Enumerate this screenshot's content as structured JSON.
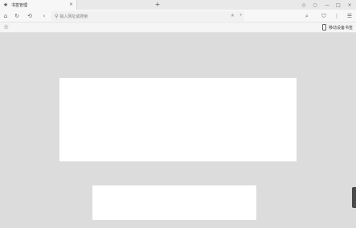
{
  "tab": {
    "title": "书签管理",
    "icon": "star-icon",
    "close": "×"
  },
  "new_tab": "+",
  "window_controls": [
    "◇",
    "○",
    "—",
    "□",
    "×"
  ],
  "toolbar": {
    "home": "⌂",
    "refresh": "↻",
    "undo": "⟲",
    "back": "‹",
    "search_icon": "🔍",
    "address_placeholder": "输入网址或搜索",
    "star": "★",
    "dropdown": "▾",
    "right_icons": [
      "⌕",
      "⛉",
      "⋮",
      "☰"
    ]
  },
  "bookmarks_bar": {
    "star": "☆",
    "mobile_label": "移动设备书签"
  }
}
